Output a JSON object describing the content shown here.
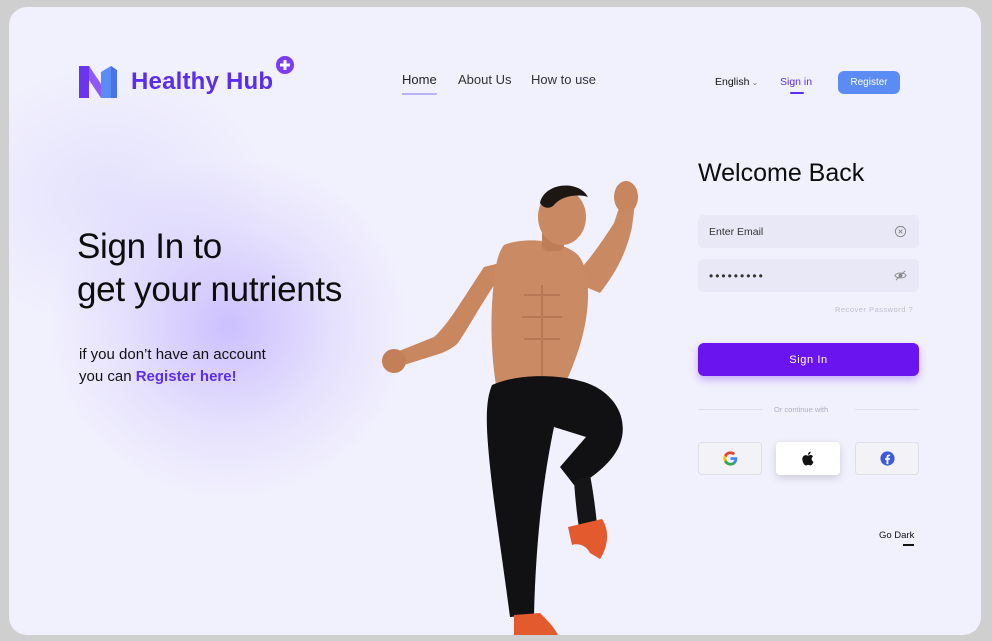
{
  "header": {
    "brand": "Healthy Hub",
    "nav": [
      "Home",
      "About Us",
      "How to use"
    ],
    "language": "English",
    "sign_in": "Sign in",
    "register": "Register"
  },
  "hero": {
    "title_line1": "Sign In to",
    "title_line2": "get your nutrients",
    "sub_line1": "if you don’t have an account",
    "sub_line2_prefix": "you can ",
    "sub_line2_link": "Register here!"
  },
  "form": {
    "title": "Welcome Back",
    "email_placeholder": "Enter Email",
    "password_value": "•••••••••",
    "recover": "Recover Password ?",
    "submit": "Sign In",
    "divider": "Or continue with"
  },
  "social": [
    "google-icon",
    "apple-icon",
    "facebook-icon"
  ],
  "footer": {
    "theme_toggle": "Go Dark"
  },
  "colors": {
    "brand_purple": "#5b2df0",
    "button_purple": "#6a14f0",
    "register_blue": "#5b8cf6",
    "background": "#f1f0fd"
  }
}
